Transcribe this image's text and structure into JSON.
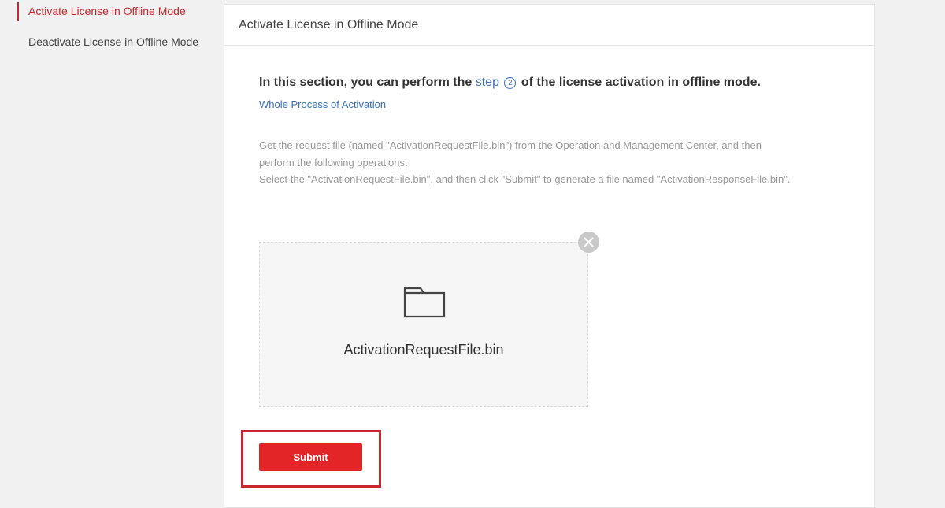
{
  "sidebar": {
    "items": [
      {
        "label": "Activate License in Offline Mode",
        "active": true
      },
      {
        "label": "Deactivate License in Offline Mode",
        "active": false
      }
    ]
  },
  "card": {
    "title": "Activate License in Offline Mode"
  },
  "main": {
    "headline_prefix": "In this section, you can perform the ",
    "step_link": "step",
    "step_number": "2",
    "headline_suffix": " of the license activation in offline mode.",
    "whole_process_link": "Whole Process of Activation",
    "description": [
      "Get the request file (named \"ActivationRequestFile.bin\") from the Operation and Management Center, and then",
      "perform the following operations:",
      "Select the \"ActivationRequestFile.bin\", and then click \"Submit\" to generate a file named \"ActivationResponseFile.bin\"."
    ]
  },
  "upload": {
    "file_name": "ActivationRequestFile.bin",
    "icon": "folder-icon",
    "remove_icon": "close-icon"
  },
  "actions": {
    "submit_label": "Submit"
  },
  "colors": {
    "accent": "#c8272e",
    "button": "#e32528",
    "link": "#3b6fb6"
  }
}
